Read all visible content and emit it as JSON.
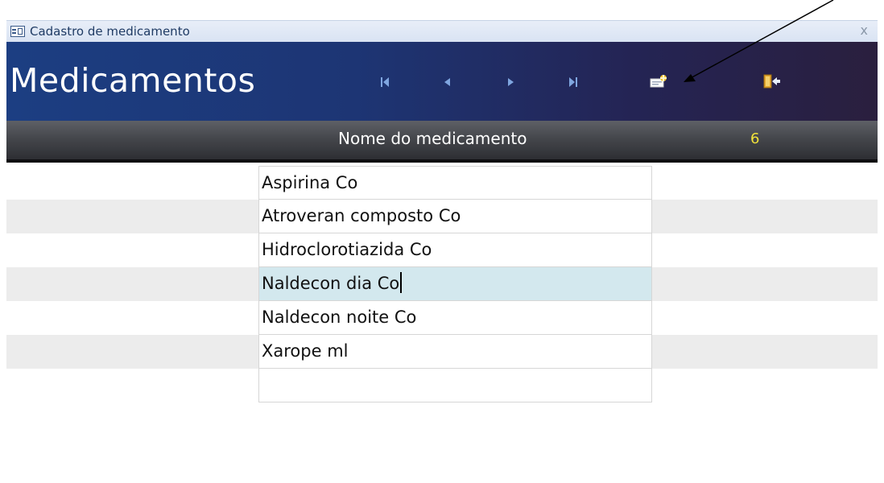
{
  "window": {
    "title": "Cadastro de medicamento",
    "close_glyph": "x"
  },
  "header": {
    "title": "Medicamentos",
    "nav_icons": [
      "first-record-icon",
      "previous-record-icon",
      "next-record-icon",
      "last-record-icon",
      "new-record-icon",
      "exit-icon"
    ]
  },
  "column": {
    "header": "Nome do medicamento",
    "count": "6"
  },
  "rows": [
    {
      "name": "Aspirina Co"
    },
    {
      "name": "Atroveran composto Co"
    },
    {
      "name": "Hidroclorotiazida Co"
    },
    {
      "name": "Naldecon dia Co"
    },
    {
      "name": "Naldecon noite Co"
    },
    {
      "name": "Xarope ml"
    },
    {
      "name": ""
    }
  ],
  "selected_row": 3,
  "colors": {
    "header_bg": "#1d3574",
    "count_color": "#f1e23a",
    "selected_row": "#d3e8ee",
    "alt_row": "#ececec"
  }
}
